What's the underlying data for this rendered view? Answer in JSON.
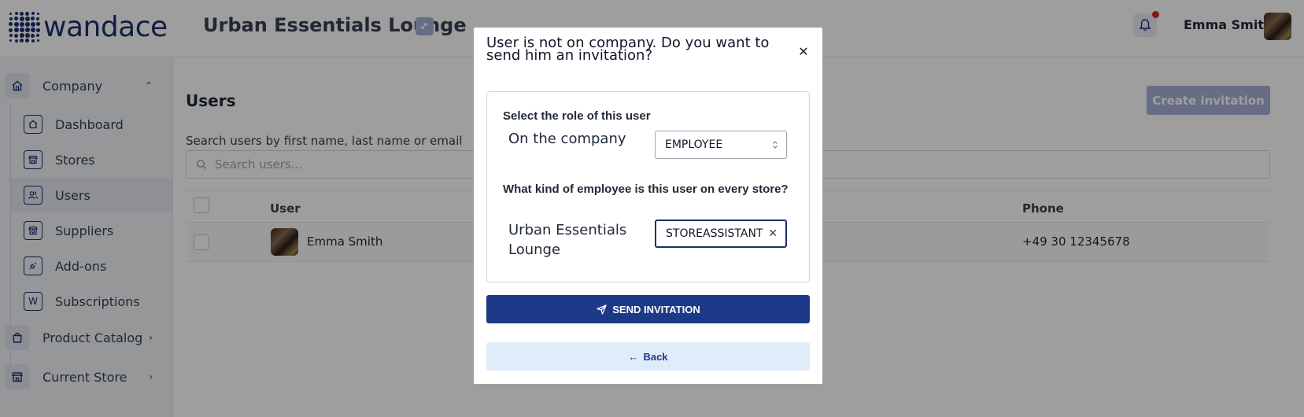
{
  "header": {
    "logo_text": "wandace",
    "store_name": "Urban Essentials Lounge",
    "user_name": "Emma Smith"
  },
  "sidebar": {
    "groups": [
      {
        "label": "Company",
        "icon": "home-icon",
        "expanded": true
      },
      {
        "label": "Product Catalog",
        "icon": "bag-icon",
        "expanded": false
      },
      {
        "label": "Current Store",
        "icon": "store-icon",
        "expanded": false
      }
    ],
    "items": [
      {
        "label": "Dashboard",
        "icon": "home-icon"
      },
      {
        "label": "Stores",
        "icon": "store-icon"
      },
      {
        "label": "Users",
        "icon": "users-icon",
        "active": true
      },
      {
        "label": "Suppliers",
        "icon": "supplier-icon"
      },
      {
        "label": "Add-ons",
        "icon": "puzzle-icon"
      },
      {
        "label": "Subscriptions",
        "icon": "subscription-icon",
        "glyph": "W"
      }
    ]
  },
  "main": {
    "title": "Users",
    "create_button": "Create invitation",
    "search_label": "Search users by first name, last name or email",
    "search_placeholder": "Search users...",
    "columns": [
      "User",
      "Phone"
    ],
    "rows": [
      {
        "name": "Emma Smith",
        "phone": "+49 30 12345678"
      }
    ]
  },
  "modal": {
    "title": "User is not on company. Do you want to send him an invitation?",
    "role_section_title": "Select the role of this user",
    "role_label": "On the company",
    "role_value": "EMPLOYEE",
    "store_section_title": "What kind of employee is this user on every store?",
    "store_label": "Urban Essentials Lounge",
    "store_role_value": "STOREASSISTANT",
    "send_button": "SEND INVITATION",
    "back_button": "Back"
  },
  "colors": {
    "brand": "#1c2f6e",
    "primary_button": "#1c3a87",
    "secondary_button": "#e1ecfb",
    "disabled_button": "#a8b1d8",
    "notification_dot": "#dc2626"
  }
}
